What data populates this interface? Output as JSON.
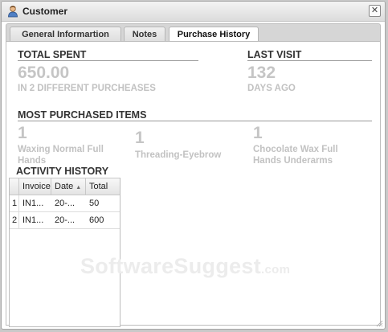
{
  "window": {
    "title": "Customer",
    "close_glyph": "✕"
  },
  "tabs": [
    {
      "label": "General Informartion",
      "active": false
    },
    {
      "label": "Notes",
      "active": false
    },
    {
      "label": "Purchase History",
      "active": true
    }
  ],
  "total_spent": {
    "heading": "TOTAL SPENT",
    "value": "650.00",
    "caption": "IN 2 DIFFERENT PURCHEASES"
  },
  "last_visit": {
    "heading": "LAST VISIT",
    "value": "132",
    "caption": "DAYS AGO"
  },
  "most_purchased": {
    "heading": "MOST PURCHASED ITEMS",
    "items": [
      {
        "count": "1",
        "name": "Waxing Normal Full Hands"
      },
      {
        "count": "1",
        "name": "Threading-Eyebrow"
      },
      {
        "count": "1",
        "name": "Chocolate Wax Full Hands Underarms"
      }
    ]
  },
  "activity_history": {
    "heading": "ACTIVITY HISTORY",
    "columns": [
      "Invoice",
      "Date",
      "Total"
    ],
    "rows": [
      {
        "num": "1",
        "invoice": "IN1...",
        "date": "20-...",
        "total": "50"
      },
      {
        "num": "2",
        "invoice": "IN1...",
        "date": "20-...",
        "total": "600"
      }
    ]
  },
  "watermark": {
    "text": "SoftwareSuggest",
    "suffix": ".com"
  },
  "icons": {
    "title": "customer-user-icon",
    "close": "close-icon",
    "sort": "sort-arrow-icon",
    "grip": "resize-grip-icon"
  }
}
